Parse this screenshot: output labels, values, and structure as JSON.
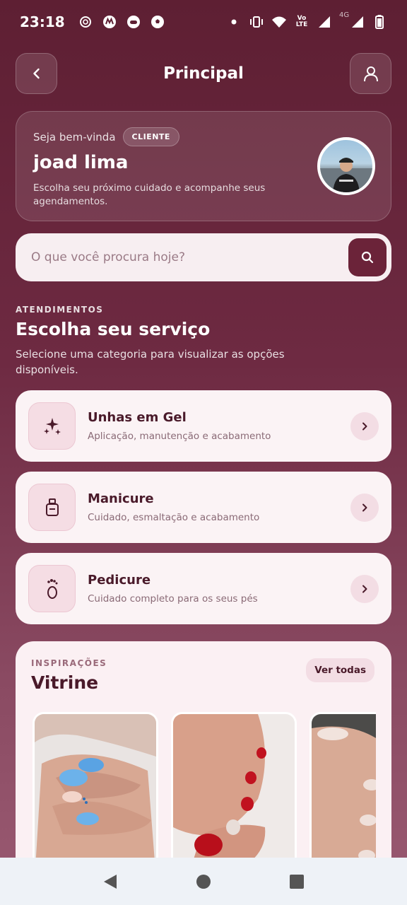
{
  "status_bar": {
    "time": "23:18",
    "left_icons": [
      "openai-icon",
      "motorola-icon",
      "game-icon",
      "soccer-icon"
    ],
    "right_icons": [
      "dot-icon",
      "vibrate-icon",
      "wifi-icon",
      "volte-icon",
      "signal-icon",
      "signal-4g-icon",
      "battery-icon"
    ],
    "volte_label": "Vo LTE",
    "network_label": "4G"
  },
  "header": {
    "title": "Principal",
    "back_icon": "chevron-left-icon",
    "profile_icon": "user-icon"
  },
  "welcome": {
    "greeting": "Seja bem-vinda",
    "badge": "CLIENTE",
    "name": "joad lima",
    "description": "Escolha seu próximo cuidado e acompanhe seus agendamentos."
  },
  "search": {
    "placeholder": "O que você procura hoje?",
    "icon": "search-icon"
  },
  "services_section": {
    "eyebrow": "ATENDIMENTOS",
    "title": "Escolha seu serviço",
    "description": "Selecione uma categoria para visualizar as opções disponíveis.",
    "items": [
      {
        "name": "Unhas em Gel",
        "subtitle": "Aplicação, manutenção e acabamento",
        "icon": "sparkles-icon"
      },
      {
        "name": "Manicure",
        "subtitle": "Cuidado, esmaltação e acabamento",
        "icon": "nail-polish-icon"
      },
      {
        "name": "Pedicure",
        "subtitle": "Cuidado completo para os seus pés",
        "icon": "foot-icon"
      }
    ]
  },
  "vitrine": {
    "eyebrow": "INSPIRAÇÕES",
    "title": "Vitrine",
    "see_all": "Ver todas",
    "photos": [
      "blue-gel-nails-photo",
      "red-pedicure-photo",
      "nude-nails-photo"
    ]
  },
  "nav_bar": {
    "buttons": [
      "back-triangle-icon",
      "home-circle-icon",
      "recents-square-icon"
    ]
  },
  "colors": {
    "background_top": "#5e1f33",
    "accent": "#6b2339",
    "card": "#fbf3f5",
    "text_dark": "#4a1a2a"
  }
}
